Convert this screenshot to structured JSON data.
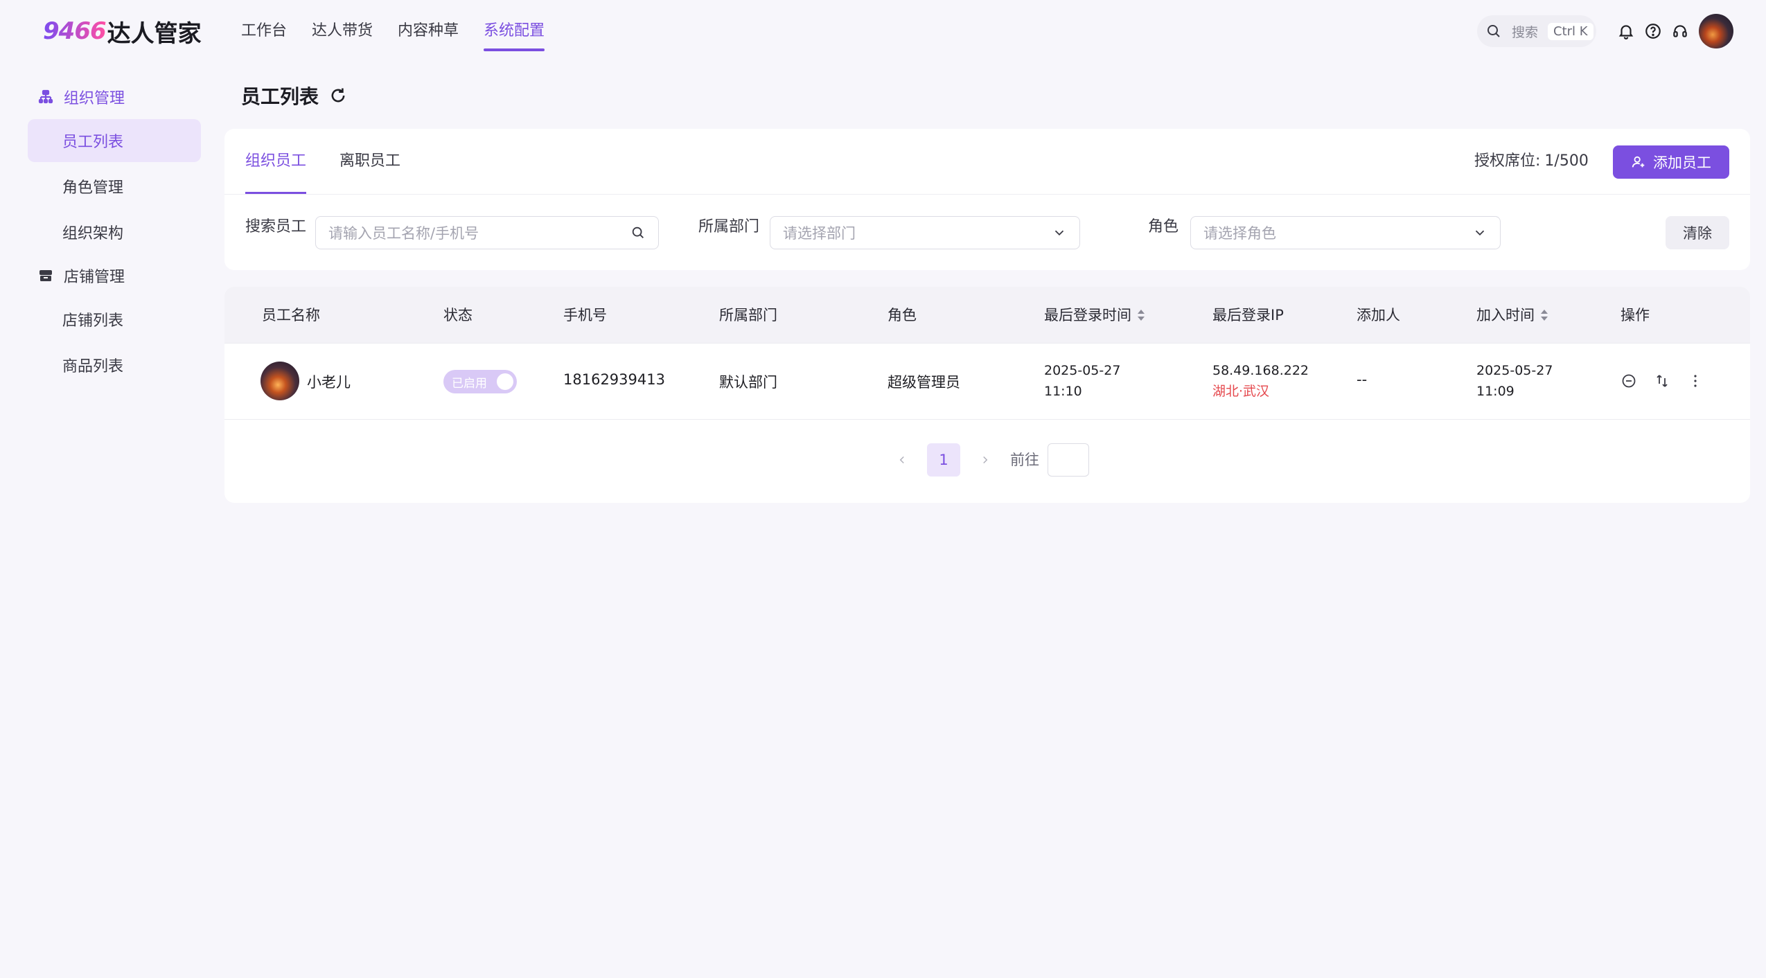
{
  "brand": {
    "logo_num": "9466",
    "logo_text": "达人管家",
    "accent": "#7b4fe0"
  },
  "topnav": {
    "items": [
      {
        "label": "工作台"
      },
      {
        "label": "达人带货"
      },
      {
        "label": "内容种草"
      },
      {
        "label": "系统配置",
        "active": true
      }
    ]
  },
  "header": {
    "search_label": "搜索",
    "search_shortcut": "Ctrl K",
    "icons": [
      "search-icon",
      "bell-icon",
      "help-icon",
      "headset-icon"
    ]
  },
  "sidebar": {
    "groups": [
      {
        "label": "组织管理",
        "icon": "org-icon",
        "active": true,
        "items": [
          {
            "label": "员工列表",
            "active": true
          },
          {
            "label": "角色管理"
          },
          {
            "label": "组织架构"
          }
        ]
      },
      {
        "label": "店铺管理",
        "icon": "store-icon",
        "items": [
          {
            "label": "店铺列表"
          },
          {
            "label": "商品列表"
          }
        ]
      }
    ]
  },
  "page": {
    "title": "员工列表"
  },
  "tabs": [
    {
      "label": "组织员工",
      "active": true
    },
    {
      "label": "离职员工"
    }
  ],
  "seats": {
    "label": "授权席位:",
    "value": "1/500"
  },
  "add_button": "添加员工",
  "filters": {
    "search": {
      "label": "搜索员工",
      "placeholder": "请输入员工名称/手机号"
    },
    "department": {
      "label": "所属部门",
      "placeholder": "请选择部门"
    },
    "role": {
      "label": "角色",
      "placeholder": "请选择角色"
    },
    "clear_button": "清除"
  },
  "table": {
    "columns": [
      "员工名称",
      "状态",
      "手机号",
      "所属部门",
      "角色",
      "最后登录时间",
      "最后登录IP",
      "添加人",
      "加入时间",
      "操作"
    ],
    "rows": [
      {
        "name": "小老儿",
        "status": "已启用",
        "phone": "18162939413",
        "department": "默认部门",
        "role": "超级管理员",
        "last_login_date": "2025-05-27",
        "last_login_time": "11:10",
        "last_ip": "58.49.168.222",
        "ip_location": "湖北·武汉",
        "added_by": "--",
        "join_date": "2025-05-27",
        "join_time": "11:09"
      }
    ]
  },
  "pagination": {
    "current": "1",
    "goto_label": "前往"
  }
}
